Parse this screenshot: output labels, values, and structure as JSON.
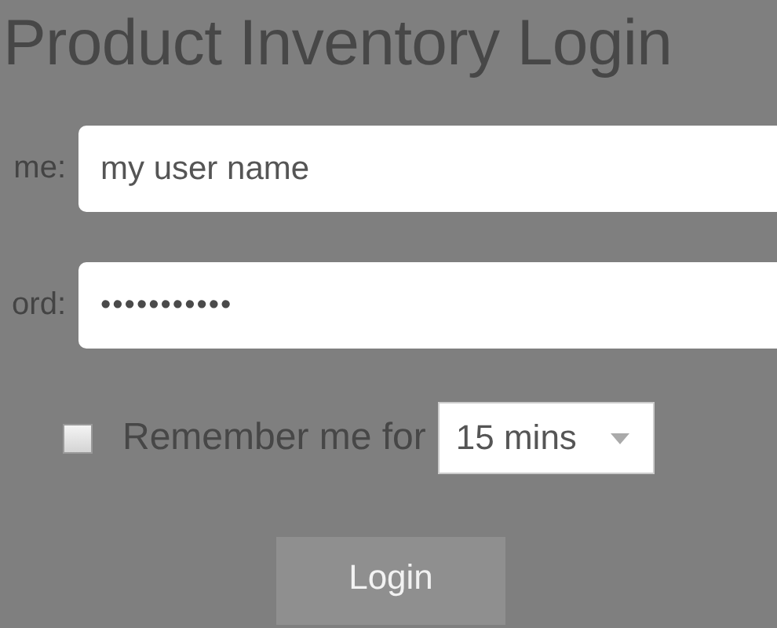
{
  "title": "Product Inventory Login",
  "fields": [
    {
      "label": "me:",
      "value": "my user name",
      "kind": "text"
    },
    {
      "label": "ord:",
      "value": "•••••••••••",
      "kind": "password"
    }
  ],
  "remember": {
    "checked": false,
    "label": "Remember me for",
    "duration": "15 mins"
  },
  "login_button": "Login"
}
